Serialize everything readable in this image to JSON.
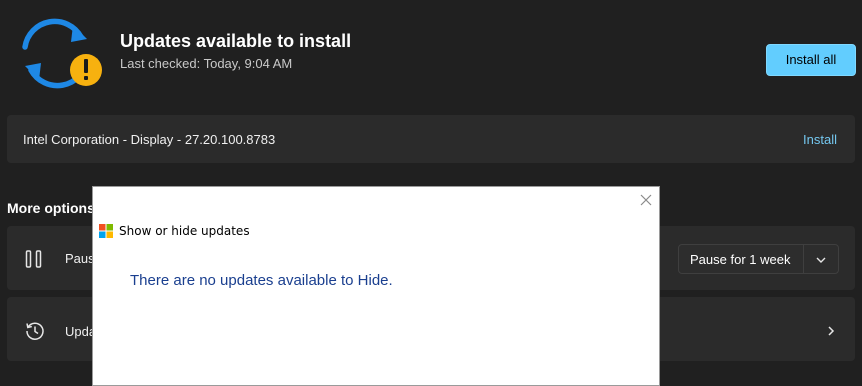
{
  "header": {
    "icon": "sync-warning-icon",
    "title": "Updates available to install",
    "last_checked": "Last checked: Today, 9:04 AM",
    "install_all_label": "Install all"
  },
  "updates": [
    {
      "name": "Intel Corporation - Display - 27.20.100.8783",
      "action_label": "Install"
    }
  ],
  "more_options": {
    "heading": "More options",
    "pause": {
      "icon": "pause-icon",
      "label": "Pause updates",
      "dropdown_value": "Pause for 1 week"
    },
    "history": {
      "icon": "history-icon",
      "label": "Update history"
    }
  },
  "dialog": {
    "title": "Show or hide updates",
    "message": "There are no updates available to Hide.",
    "close_icon": "close-icon"
  },
  "colors": {
    "accent": "#62cdfe",
    "warning": "#f7b10f",
    "sync_blue": "#1e88e5",
    "dialog_text": "#1a3f8f"
  }
}
